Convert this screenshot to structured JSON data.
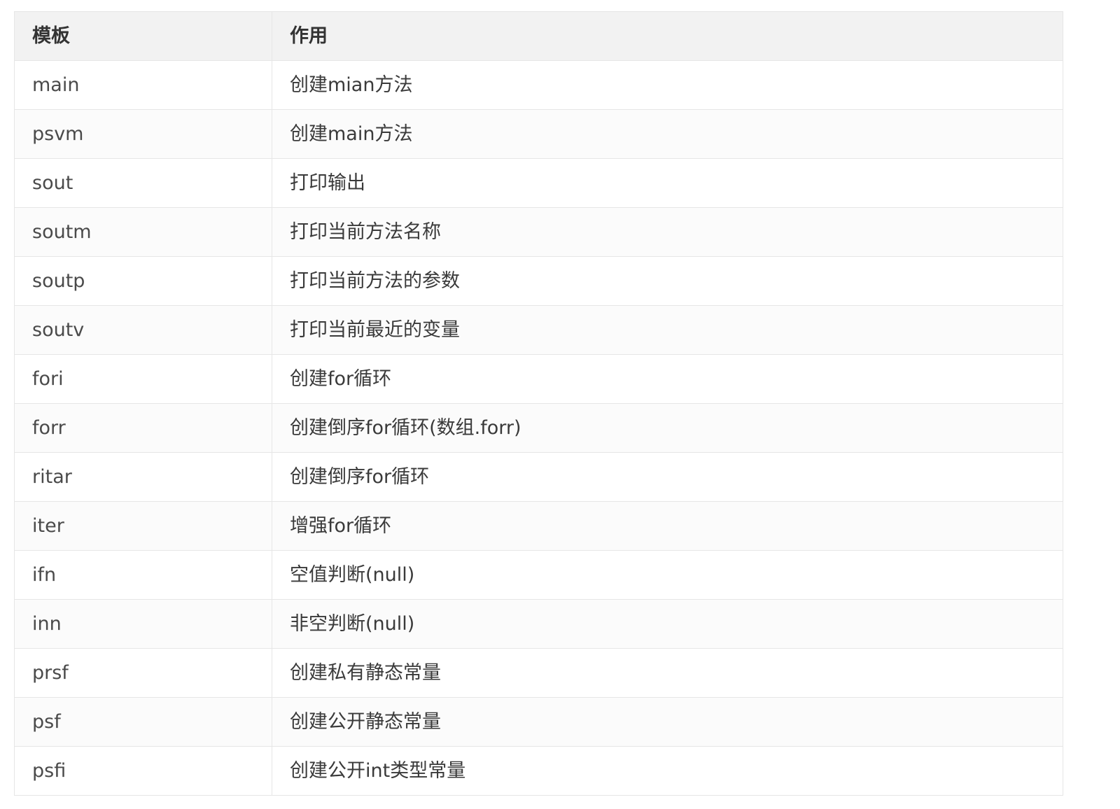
{
  "table": {
    "headers": [
      "模板",
      "作用"
    ],
    "rows": [
      {
        "template": "main",
        "purpose": "创建mian方法"
      },
      {
        "template": "psvm",
        "purpose": "创建main方法"
      },
      {
        "template": "sout",
        "purpose": "打印输出"
      },
      {
        "template": "soutm",
        "purpose": "打印当前方法名称"
      },
      {
        "template": "soutp",
        "purpose": "打印当前方法的参数"
      },
      {
        "template": "soutv",
        "purpose": "打印当前最近的变量"
      },
      {
        "template": "fori",
        "purpose": "创建for循环"
      },
      {
        "template": "forr",
        "purpose": "创建倒序for循环(数组.forr)"
      },
      {
        "template": "ritar",
        "purpose": "创建倒序for循环"
      },
      {
        "template": "iter",
        "purpose": "增强for循环"
      },
      {
        "template": "ifn",
        "purpose": "空值判断(null)"
      },
      {
        "template": "inn",
        "purpose": "非空判断(null)"
      },
      {
        "template": "prsf",
        "purpose": "创建私有静态常量"
      },
      {
        "template": "psf",
        "purpose": "创建公开静态常量"
      },
      {
        "template": "psfi",
        "purpose": "创建公开int类型常量"
      }
    ]
  },
  "colors": {
    "header_bg": "#f2f2f2",
    "border": "#e6e6e6",
    "text": "#333333"
  }
}
